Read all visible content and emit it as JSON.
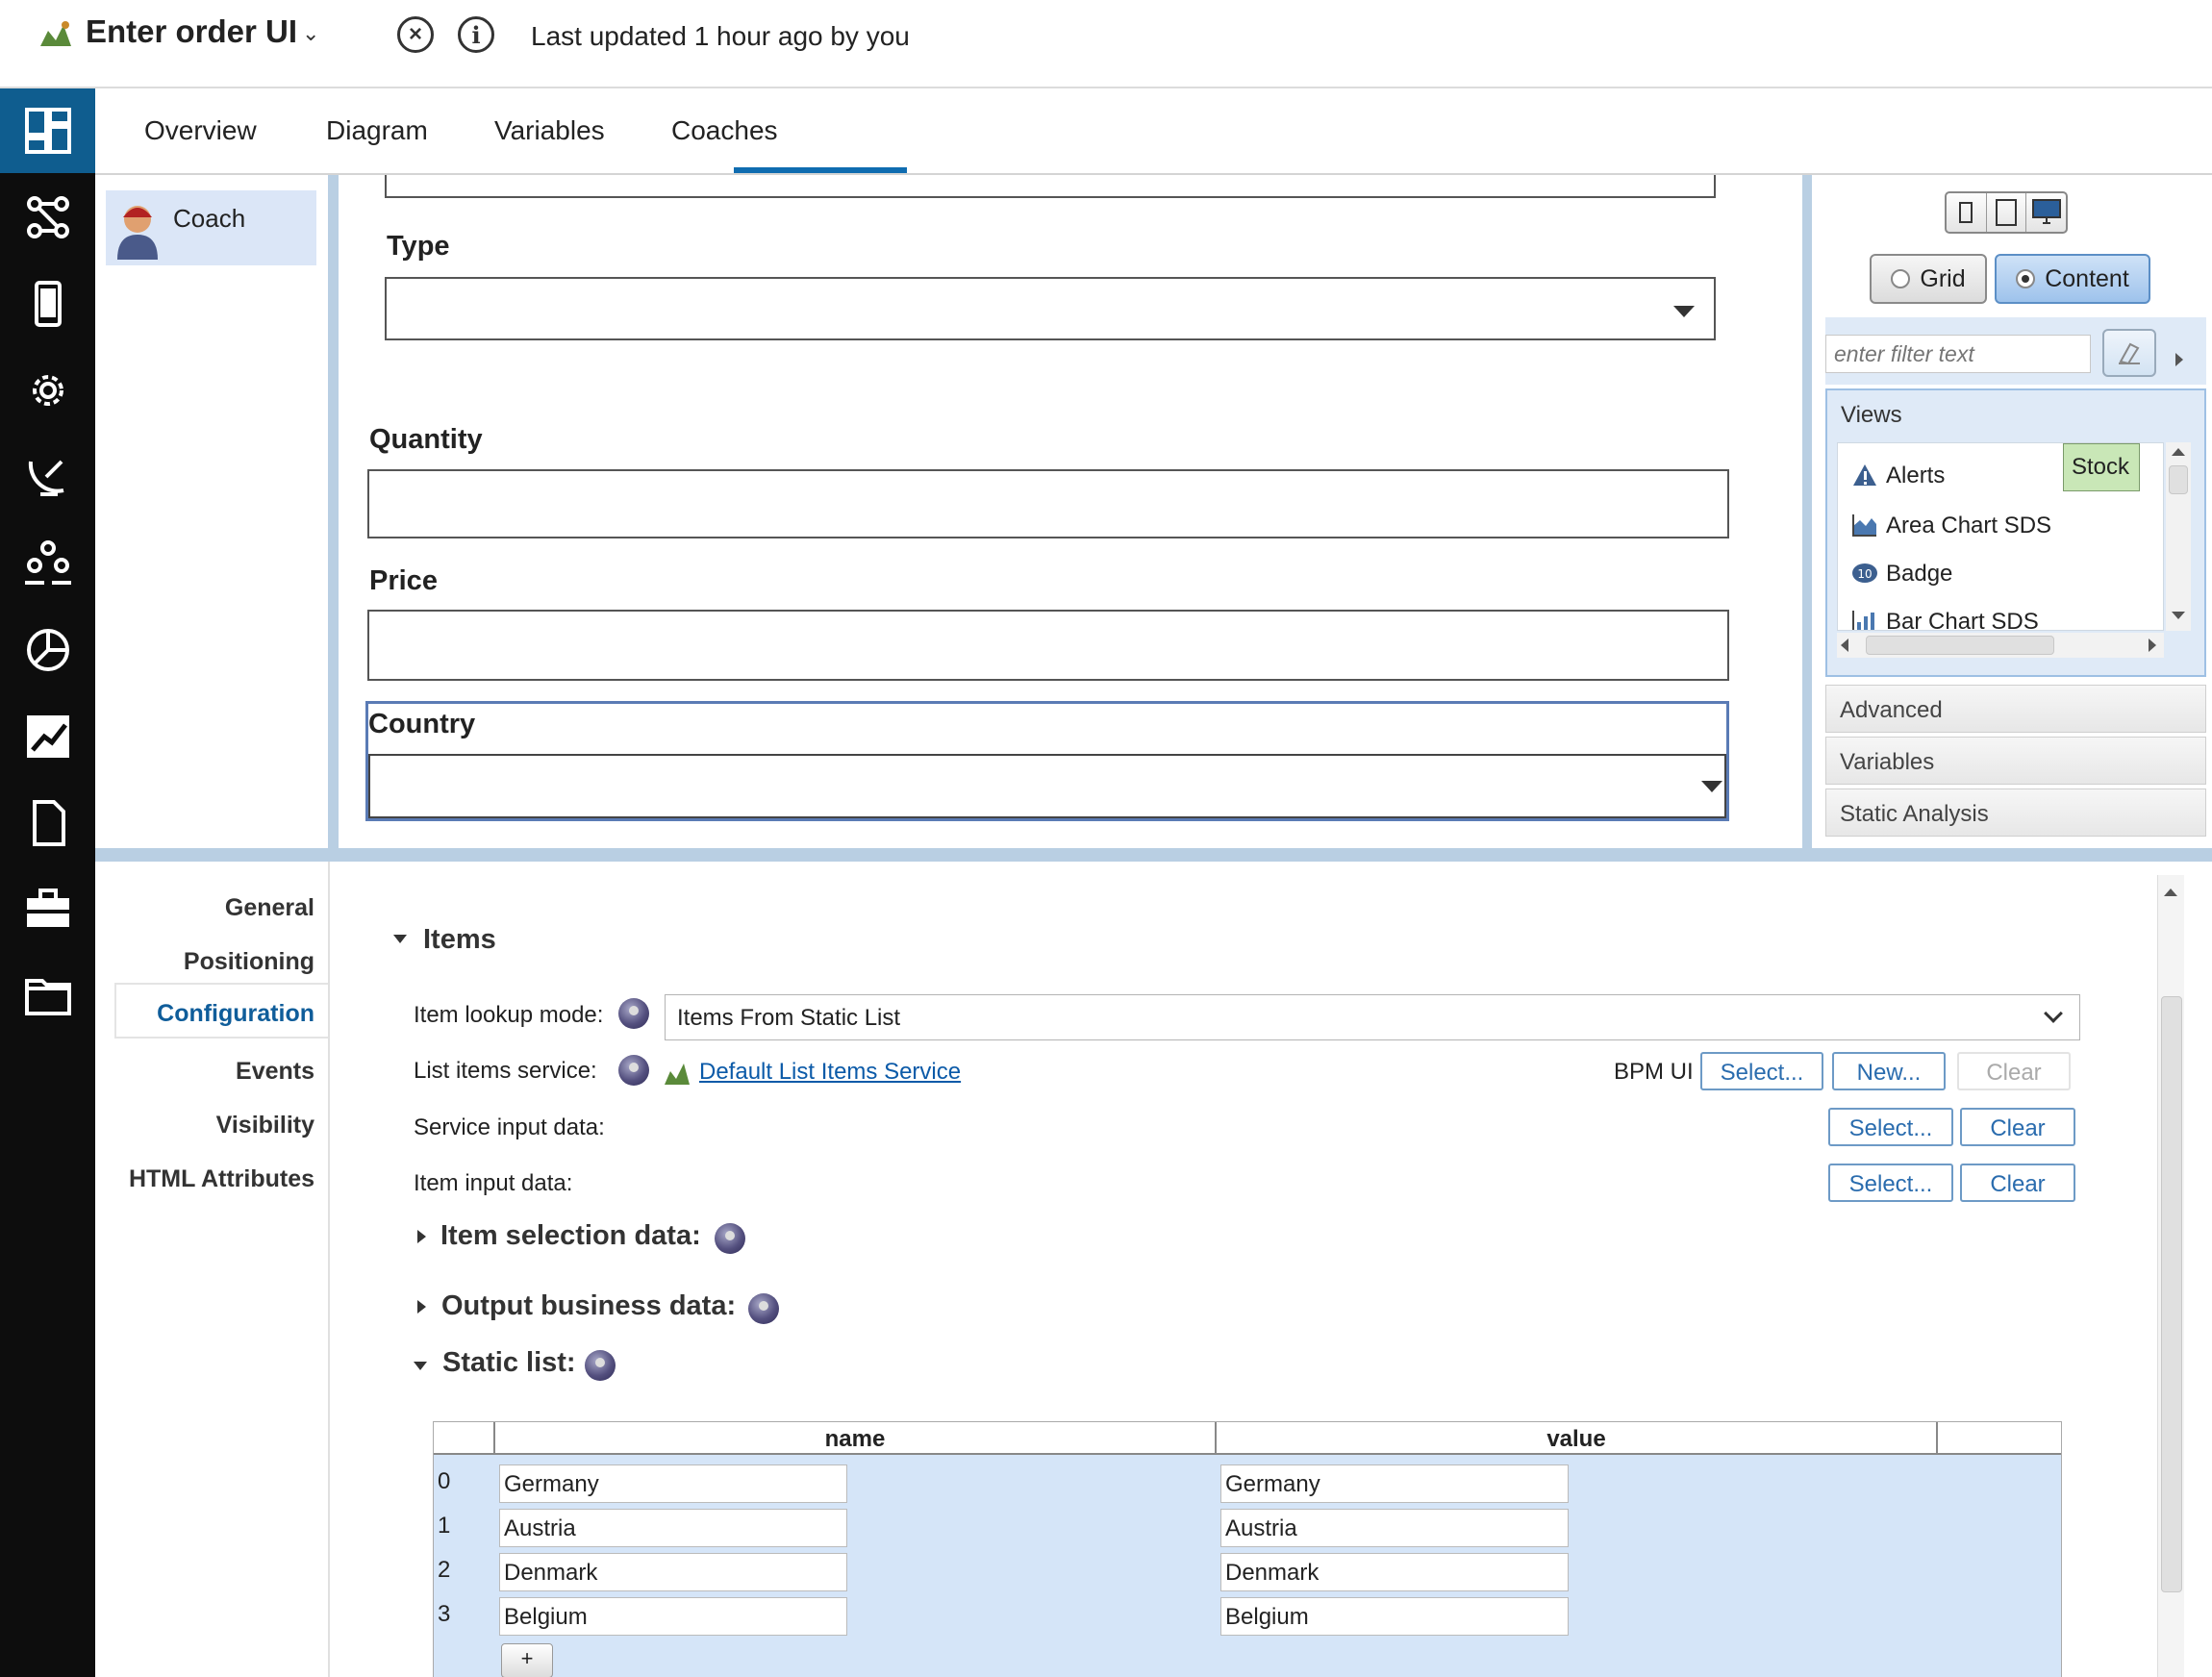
{
  "header": {
    "title": "Enter order UI",
    "last_updated": "Last updated 1 hour ago by you"
  },
  "tabs": [
    {
      "label": "Overview"
    },
    {
      "label": "Diagram"
    },
    {
      "label": "Variables"
    },
    {
      "label": "Coaches"
    }
  ],
  "active_tab": "Coaches",
  "coach_list": {
    "items": [
      {
        "label": "Coach"
      }
    ]
  },
  "canvas": {
    "fields": {
      "type_label": "Type",
      "quantity_label": "Quantity",
      "price_label": "Price",
      "country_label": "Country"
    }
  },
  "palette": {
    "modes": {
      "grid": "Grid",
      "content": "Content"
    },
    "selected_mode": "Content",
    "filter_placeholder": "enter filter text",
    "views_title": "Views",
    "views": [
      {
        "label": "Alerts",
        "icon": "alert-triangle-icon"
      },
      {
        "label": "Area Chart SDS",
        "icon": "area-chart-icon"
      },
      {
        "label": "Badge",
        "icon": "badge-icon"
      },
      {
        "label": "Bar Chart SDS",
        "icon": "bar-chart-icon"
      }
    ],
    "stock_label": "Stock",
    "sections": [
      "Advanced",
      "Variables",
      "Static Analysis"
    ]
  },
  "properties": {
    "nav": [
      "General",
      "Positioning",
      "Configuration",
      "Events",
      "Visibility",
      "HTML Attributes"
    ],
    "active_nav": "Configuration",
    "items_title": "Items",
    "item_lookup_label": "Item lookup mode:",
    "item_lookup_value": "Items From Static List",
    "list_items_service_label": "List items service:",
    "list_items_service_link": "Default List Items Service",
    "bpm_ui_label": "BPM UI",
    "select_label": "Select...",
    "new_label": "New...",
    "clear_label": "Clear",
    "service_input_label": "Service input data:",
    "item_input_label": "Item input data:",
    "item_selection_title": "Item selection data:",
    "output_business_title": "Output business data:",
    "static_list_title": "Static list:",
    "table": {
      "columns": [
        "name",
        "value"
      ],
      "rows": [
        {
          "index": "0",
          "name": "Germany",
          "value": "Germany"
        },
        {
          "index": "1",
          "name": "Austria",
          "value": "Austria"
        },
        {
          "index": "2",
          "name": "Denmark",
          "value": "Denmark"
        },
        {
          "index": "3",
          "name": "Belgium",
          "value": "Belgium"
        }
      ],
      "add_label": "+"
    }
  },
  "colors": {
    "rail_bg": "#0d0d0d",
    "rail_active": "#0f5d8f",
    "tab_underline": "#0f6cb0",
    "link": "#0b5aa8",
    "stock_bg": "#c9e7b7"
  }
}
